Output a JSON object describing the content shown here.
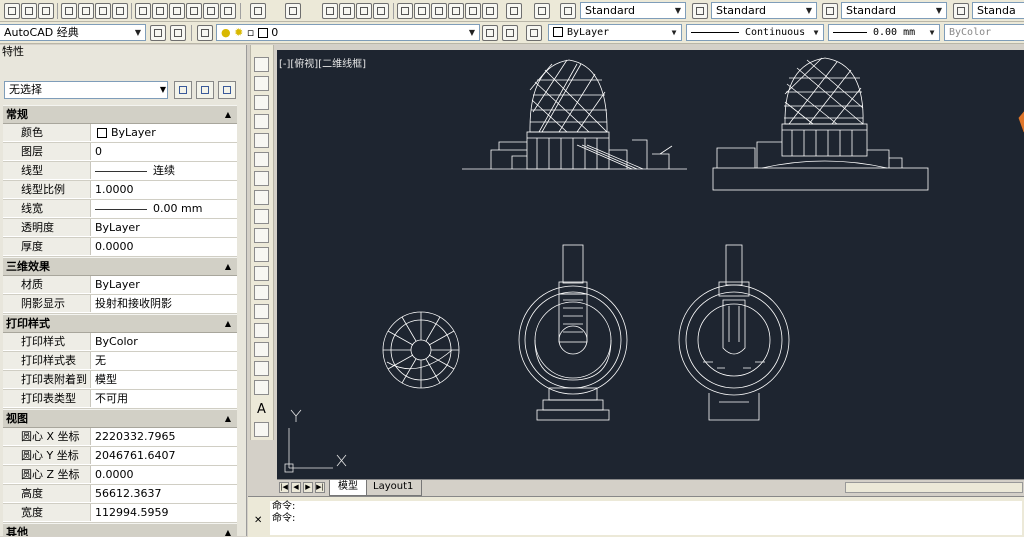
{
  "toolbar": {
    "text_style": "Standard",
    "dim_style": "Standard",
    "table_style": "Standard",
    "mleader_style": "Standa"
  },
  "workspace": "AutoCAD 经典",
  "layer": "0",
  "color": "ByLayer",
  "linetype": "Continuous",
  "lineweight": "0.00 mm",
  "plotstyle": "ByColor",
  "properties": {
    "title": "特性",
    "selection": "无选择",
    "sections": [
      {
        "name": "常规",
        "rows": [
          {
            "key": "颜色",
            "value": "ByLayer"
          },
          {
            "key": "图层",
            "value": "0"
          },
          {
            "key": "线型",
            "value": "连续"
          },
          {
            "key": "线型比例",
            "value": "1.0000"
          },
          {
            "key": "线宽",
            "value": "0.00 mm"
          },
          {
            "key": "透明度",
            "value": "ByLayer"
          },
          {
            "key": "厚度",
            "value": "0.0000"
          }
        ]
      },
      {
        "name": "三维效果",
        "rows": [
          {
            "key": "材质",
            "value": "ByLayer"
          },
          {
            "key": "阴影显示",
            "value": "投射和接收阴影"
          }
        ]
      },
      {
        "name": "打印样式",
        "rows": [
          {
            "key": "打印样式",
            "value": "ByColor"
          },
          {
            "key": "打印样式表",
            "value": "无"
          },
          {
            "key": "打印表附着到",
            "value": "模型"
          },
          {
            "key": "打印表类型",
            "value": "不可用"
          }
        ]
      },
      {
        "name": "视图",
        "rows": [
          {
            "key": "圆心 X 坐标",
            "value": "2220332.7965"
          },
          {
            "key": "圆心 Y 坐标",
            "value": "2046761.6407"
          },
          {
            "key": "圆心 Z 坐标",
            "value": "0.0000"
          },
          {
            "key": "高度",
            "value": "56612.3637"
          },
          {
            "key": "宽度",
            "value": "112994.5959"
          }
        ]
      },
      {
        "name": "其他",
        "rows": []
      }
    ]
  },
  "viewport_label": "[-][俯视][二维线框]",
  "ucs": {
    "x": "X",
    "y": "Y"
  },
  "tabs": [
    "模型",
    "Layout1"
  ],
  "command": {
    "lines": [
      "命令:",
      "命令:"
    ]
  },
  "colors": {
    "canvas": "#1e2530",
    "drawing": "#ffffff",
    "accent": "#e0762a"
  }
}
